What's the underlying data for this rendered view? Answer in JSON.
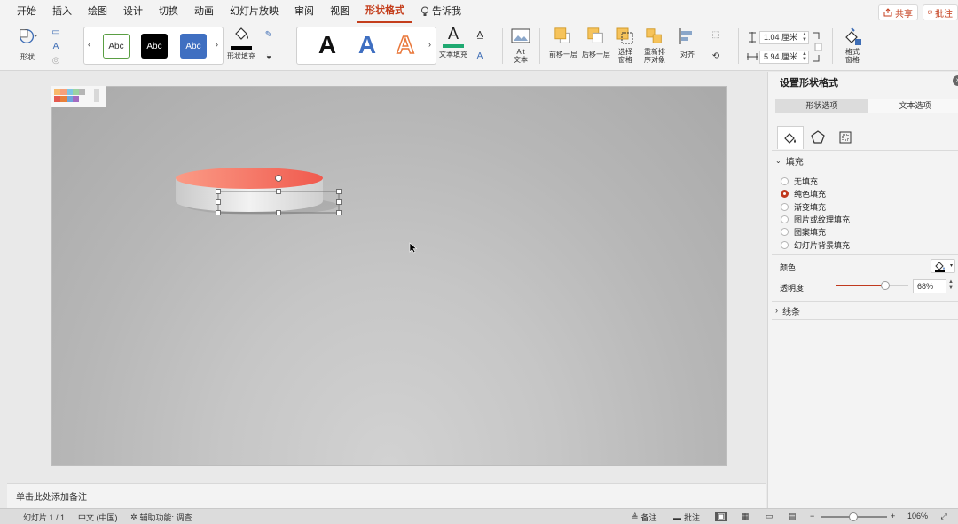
{
  "menu": {
    "tabs": [
      "开始",
      "插入",
      "绘图",
      "设计",
      "切换",
      "动画",
      "幻灯片放映",
      "审阅",
      "视图",
      "形状格式"
    ],
    "active_tab": "形状格式",
    "tell_me": "告诉我",
    "share": "共享",
    "comments": "批注"
  },
  "ribbon": {
    "shape_label": "形状",
    "style_samples": [
      "Abc",
      "Abc",
      "Abc"
    ],
    "shape_fill_label": "形状填充",
    "wordart_samples": [
      "A",
      "A",
      "A"
    ],
    "text_fill_label": "文本填充",
    "alt_text_label_1": "Alt",
    "alt_text_label_2": "文本",
    "bring_forward": "前移一层",
    "send_backward": "后移一层",
    "selection_pane_1": "选择",
    "selection_pane_2": "窗格",
    "reorder_1": "重新排",
    "reorder_2": "序对象",
    "align": "对齐",
    "height_value": "1.04 厘米",
    "width_value": "5.94 厘米",
    "format_pane_1": "格式",
    "format_pane_2": "窗格",
    "colors": {
      "accent": "#c43e1c",
      "fill_black": "#000000",
      "text_fill_green": "#1fa971",
      "abc_blue": "#3f6fc1",
      "abc_outline_green": "#5a9e43"
    }
  },
  "slide": {
    "shape_top_color": "#f26c5c",
    "shape_top_color_light": "#fb9b86",
    "palette_colors": [
      "#f8b96b",
      "#f6a07a",
      "#7fc6e4",
      "#9bd3a2",
      "#b5b5b5",
      "#e45a4f",
      "#e8803a",
      "#6ea6db",
      "#a36bc1",
      "#d8d8d8"
    ]
  },
  "notes": {
    "placeholder": "单击此处添加备注"
  },
  "pane": {
    "title": "设置形状格式",
    "tabs": [
      "形状选项",
      "文本选项"
    ],
    "icons": [
      "fill-line-icon",
      "effects-pentagon-icon",
      "size-properties-icon"
    ],
    "fill_section": "填充",
    "fill_options": [
      "无填充",
      "纯色填充",
      "渐变填充",
      "图片或纹理填充",
      "图案填充",
      "幻灯片背景填充"
    ],
    "selected_fill": "纯色填充",
    "color_label": "颜色",
    "transparency_label": "透明度",
    "transparency_value": "68%",
    "transparency_fraction": 0.68,
    "line_section": "线条"
  },
  "status": {
    "slide_info": "幻灯片 1 / 1",
    "language": "中文 (中国)",
    "accessibility": "辅助功能: 调查",
    "notes_btn": "备注",
    "comments_btn": "批注",
    "zoom": "106%"
  }
}
